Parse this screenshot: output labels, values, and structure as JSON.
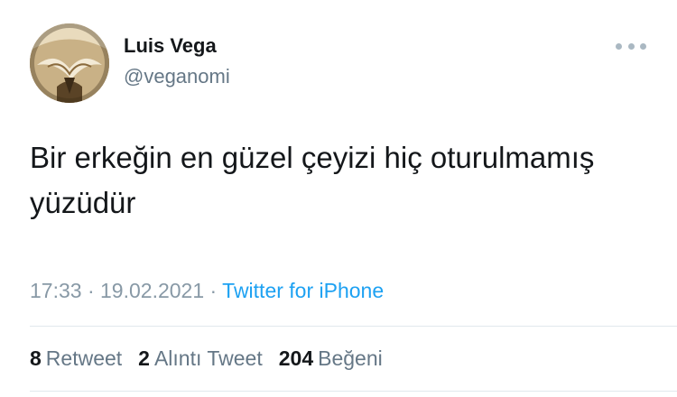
{
  "user": {
    "display_name": "Luis Vega",
    "handle": "@veganomi"
  },
  "tweet": {
    "text_line1": "Bir erkeğin en güzel çeyizi hiç oturulmamış",
    "text_line2": "yüzüdür"
  },
  "meta": {
    "time": "17:33",
    "sep1": " · ",
    "date": "19.02.2021",
    "sep2": " · ",
    "source": "Twitter for iPhone"
  },
  "stats": {
    "retweets": {
      "count": "8",
      "label": "Retweet"
    },
    "quotes": {
      "count": "2",
      "label": "Alıntı Tweet"
    },
    "likes": {
      "count": "204",
      "label": "Beğeni"
    }
  },
  "icons": {
    "more": "more-dots-icon"
  },
  "colors": {
    "text": "#14171a",
    "secondary": "#657786",
    "meta": "#8899a6",
    "link": "#1da1f2",
    "divider": "#e1e8ed"
  }
}
